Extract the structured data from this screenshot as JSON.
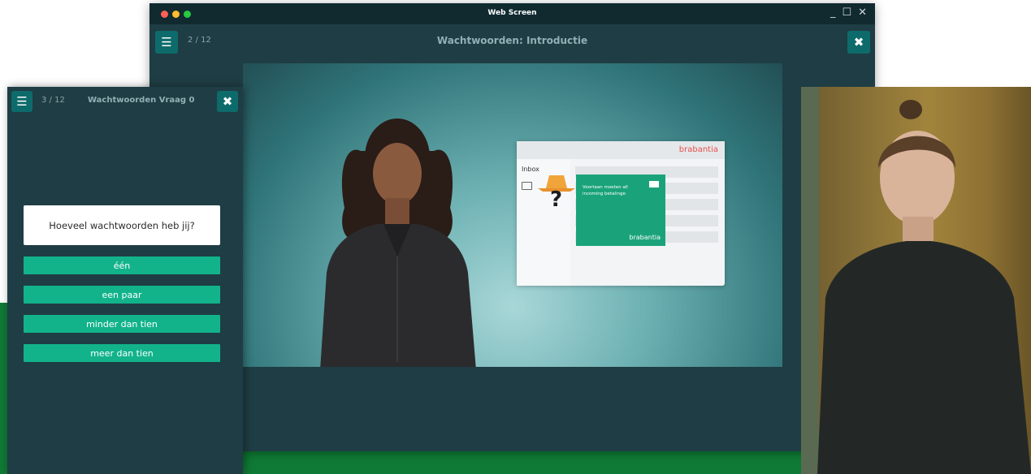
{
  "back_window": {
    "window_title": "Web Screen",
    "counter": "2 / 12",
    "title": "Wachtwoorden: Introductie",
    "menu_icon": "hamburger-menu-icon",
    "close_icon": "close-x-icon"
  },
  "mail_mock": {
    "brand": "brabantia",
    "inbox_label": "Inbox",
    "message_text": "Voortaan moeten all incoming betalinge",
    "card_brand": "brabantia"
  },
  "front_window": {
    "counter": "3 / 12",
    "title": "Wachtwoorden Vraag 0",
    "question": "Hoeveel wachtwoorden heb jij?",
    "answers": [
      "één",
      "een paar",
      "minder dan tien",
      "meer dan tien"
    ]
  },
  "colors": {
    "panel": "#1f3d44",
    "accent": "#12b38b",
    "green_band": "#0f7a35"
  }
}
